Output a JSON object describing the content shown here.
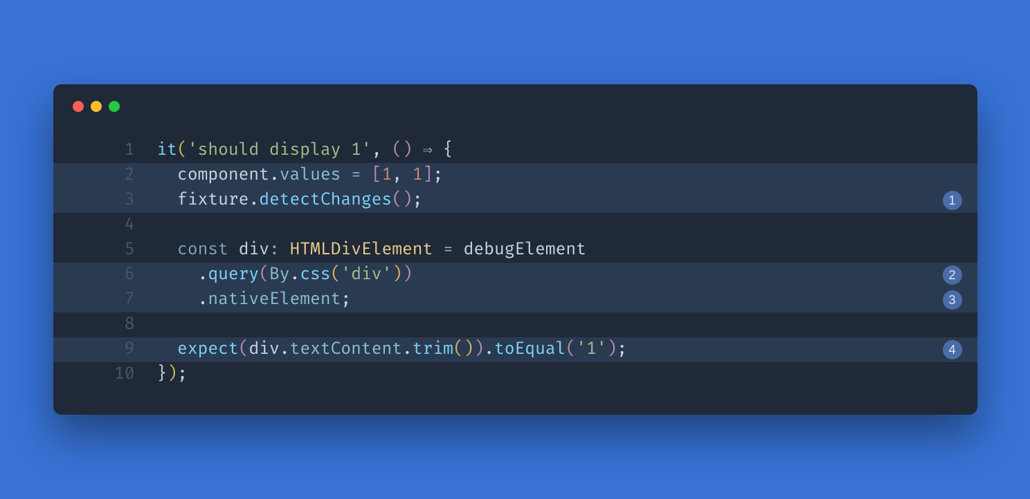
{
  "window": {
    "traffic_lights": [
      "close",
      "minimize",
      "zoom"
    ]
  },
  "code": {
    "lines": [
      {
        "num": "1",
        "highlighted": false,
        "annotation": null
      },
      {
        "num": "2",
        "highlighted": true,
        "annotation": null
      },
      {
        "num": "3",
        "highlighted": true,
        "annotation": "1"
      },
      {
        "num": "4",
        "highlighted": false,
        "annotation": null
      },
      {
        "num": "5",
        "highlighted": false,
        "annotation": null
      },
      {
        "num": "6",
        "highlighted": true,
        "annotation": "2"
      },
      {
        "num": "7",
        "highlighted": true,
        "annotation": "3"
      },
      {
        "num": "8",
        "highlighted": false,
        "annotation": null
      },
      {
        "num": "9",
        "highlighted": true,
        "annotation": "4"
      },
      {
        "num": "10",
        "highlighted": false,
        "annotation": null
      }
    ],
    "tokens": {
      "l1": {
        "it": "it",
        "open1": "(",
        "str": "'should display 1'",
        "comma": ", ",
        "open2": "(",
        "close2": ")",
        "arrow": " ⇒ ",
        "brace": "{"
      },
      "l2": {
        "indent": "  ",
        "component": "component",
        "dot": ".",
        "values": "values",
        "eq": " = ",
        "open": "[",
        "n1": "1",
        "comma": ", ",
        "n2": "1",
        "close": "]",
        "semi": ";"
      },
      "l3": {
        "indent": "  ",
        "fixture": "fixture",
        "dot": ".",
        "detectChanges": "detectChanges",
        "open": "(",
        "close": ")",
        "semi": ";"
      },
      "l4": {
        "blank": ""
      },
      "l5": {
        "indent": "  ",
        "const": "const",
        "sp": " ",
        "div": "div",
        "colon": ": ",
        "type": "HTMLDivElement",
        "eq": " = ",
        "debugElement": "debugElement"
      },
      "l6": {
        "indent": "    ",
        "dot": ".",
        "query": "query",
        "open1": "(",
        "By": "By",
        "dot2": ".",
        "css": "css",
        "open2": "(",
        "str": "'div'",
        "close2": ")",
        "close1": ")"
      },
      "l7": {
        "indent": "    ",
        "dot": ".",
        "nativeElement": "nativeElement",
        "semi": ";"
      },
      "l8": {
        "blank": ""
      },
      "l9": {
        "indent": "  ",
        "expect": "expect",
        "open1": "(",
        "div": "div",
        "dot1": ".",
        "textContent": "textContent",
        "dot2": ".",
        "trim": "trim",
        "open2": "(",
        "close2": ")",
        "close1": ")",
        "dot3": ".",
        "toEqual": "toEqual",
        "open3": "(",
        "str": "'1'",
        "close3": ")",
        "semi": ";"
      },
      "l10": {
        "closeBrace": "}",
        "closeParen": ")",
        "semi": ";"
      }
    }
  }
}
